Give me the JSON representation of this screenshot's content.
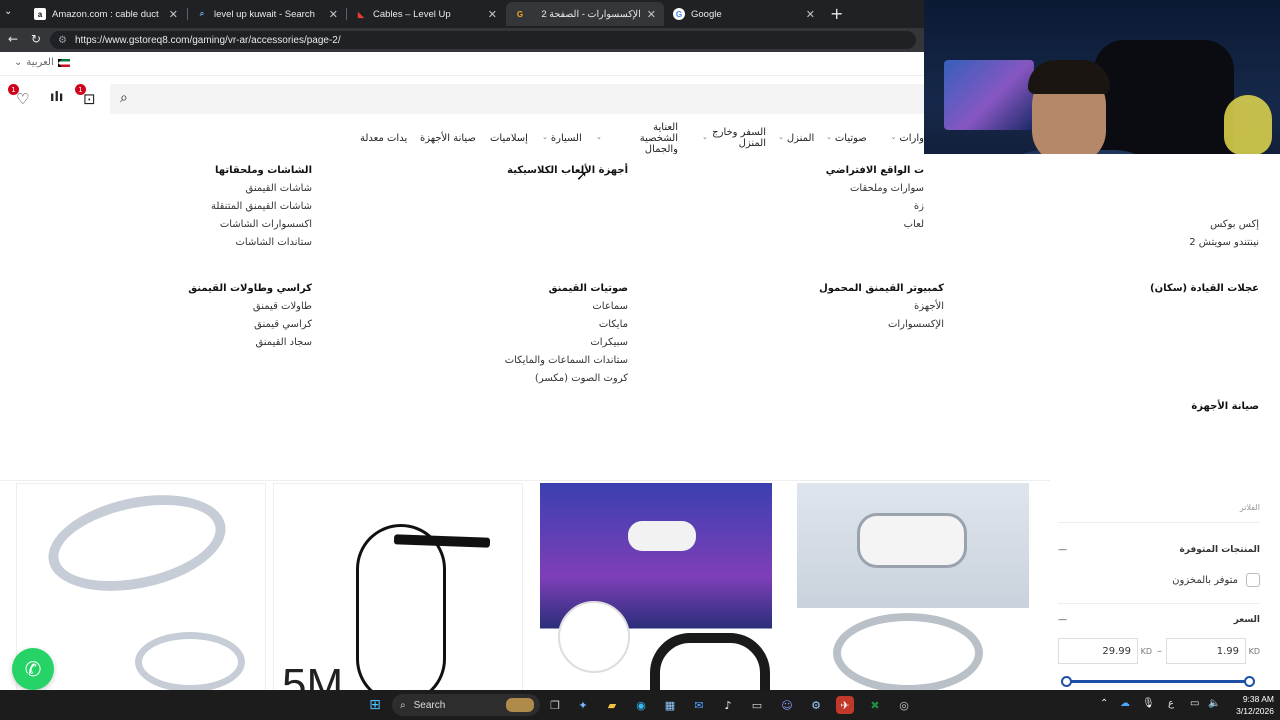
{
  "browser": {
    "tabs": [
      {
        "title": "Amazon.com : cable duct",
        "favicon": "a"
      },
      {
        "title": "level up kuwait - Search",
        "favicon": "⌕"
      },
      {
        "title": "Cables – Level Up",
        "favicon": "◣"
      },
      {
        "title": "الإكسسوارات - الصفحة 2",
        "favicon": "G"
      },
      {
        "title": "Google",
        "favicon": "G"
      }
    ],
    "url": "https://www.gstoreq8.com/gaming/vr-ar/accessories/page-2/"
  },
  "site": {
    "language": "العربية",
    "badges": {
      "wishlist": "1",
      "cart": "1"
    },
    "nav": [
      {
        "label": "وارات"
      },
      {
        "label": "صوتيات"
      },
      {
        "label": "المنزل"
      },
      {
        "label": "السفر وخارج المنزل"
      },
      {
        "label": "العناية الشخصية والجمال"
      },
      {
        "label": "السيارة"
      },
      {
        "label": "إسلاميات"
      },
      {
        "label": "صيانة الأجهزة"
      },
      {
        "label": "يدات معدلة"
      }
    ],
    "mega": {
      "col1": {
        "heading": "الشاشات وملحقاتها",
        "items": [
          "شاشات القيمنق",
          "شاشات القيمنق المتنقلة",
          "اكسسوارات الشاشات",
          "ستاندات الشاشات"
        ]
      },
      "col2": {
        "heading": "أجهزة الألعاب الكلاسيكية",
        "items": []
      },
      "col3": {
        "heading": "ت الواقع الافتراضي",
        "items": [
          "سوارات وملحقات",
          "زة",
          "لعاب"
        ]
      },
      "col4": {
        "heading": "",
        "items": [
          "نينتندو سويتش",
          "إكس بوكس",
          "نينتندو سويتش 2"
        ]
      },
      "col5": {
        "heading": "كراسي وطاولات القيمنق",
        "items": [
          "طاولات قيمنق",
          "كراسي قيمنق",
          "سجاد القيمنق"
        ]
      },
      "col6": {
        "heading": "صوتيات القيمنق",
        "items": [
          "سماعات",
          "مايكات",
          "سبيكرات",
          "ستاندات السماعات والمايكات",
          "كروت الصوت (مكسر)"
        ]
      },
      "col7": {
        "heading": "كمبيوتر القيمنق المحمول",
        "items": [
          "الأجهزة",
          "الإكسسوارات"
        ]
      },
      "col8": {
        "heading": "عجلات القيادة (سكان)",
        "items": []
      },
      "col9": {
        "heading": "صيانة الأجهزة",
        "items": []
      }
    },
    "products": {
      "card2_text": "5M"
    },
    "filters": {
      "title": "الفلاتر",
      "availability_heading": "المنتجات المتوفرة",
      "in_stock_label": "متوفر بالمخزون",
      "price_heading": "السعر",
      "price_min": "1.99",
      "price_max": "29.99",
      "currency": "KD",
      "range_sep": "–",
      "collapse": "—"
    }
  },
  "taskbar": {
    "search_label": "Search",
    "time": "9:38 AM",
    "date": "3/12/2026",
    "lang": "ع"
  },
  "colors": {
    "accent": "#1e4fa8",
    "badge": "#d0021b",
    "whatsapp": "#25d366"
  }
}
